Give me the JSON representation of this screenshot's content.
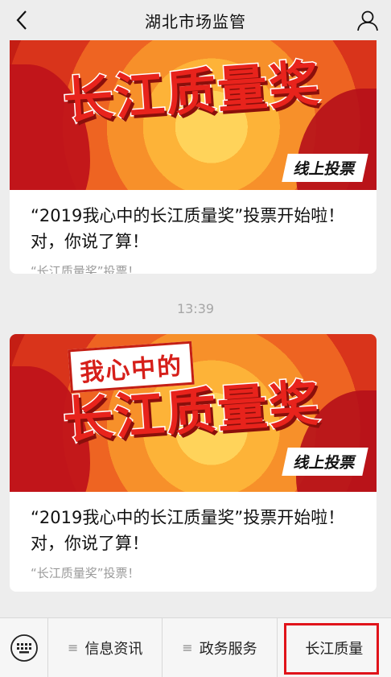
{
  "nav": {
    "title": "湖北市场监管"
  },
  "articles": [
    {
      "banner": {
        "main_text": "长江质量奖",
        "tag": "线上投票"
      },
      "title": "“2019我心中的长江质量奖”投票开始啦！对，你说了算！",
      "source": "“长江质量奖”投票！"
    },
    {
      "banner": {
        "sub_text": "我心中的",
        "main_text": "长江质量奖",
        "tag": "线上投票"
      },
      "title": "“2019我心中的长江质量奖”投票开始啦！对，你说了算！",
      "source": "“长江质量奖”投票！"
    }
  ],
  "timestamp": "13:39",
  "bottom_menu": {
    "items": [
      {
        "label": "信息资讯",
        "has_submenu": true
      },
      {
        "label": "政务服务",
        "has_submenu": true
      },
      {
        "label": "长江质量",
        "has_submenu": false
      }
    ]
  },
  "colors": {
    "background": "#ededed",
    "banner_red": "#d9341b",
    "highlight": "#e0131a"
  }
}
